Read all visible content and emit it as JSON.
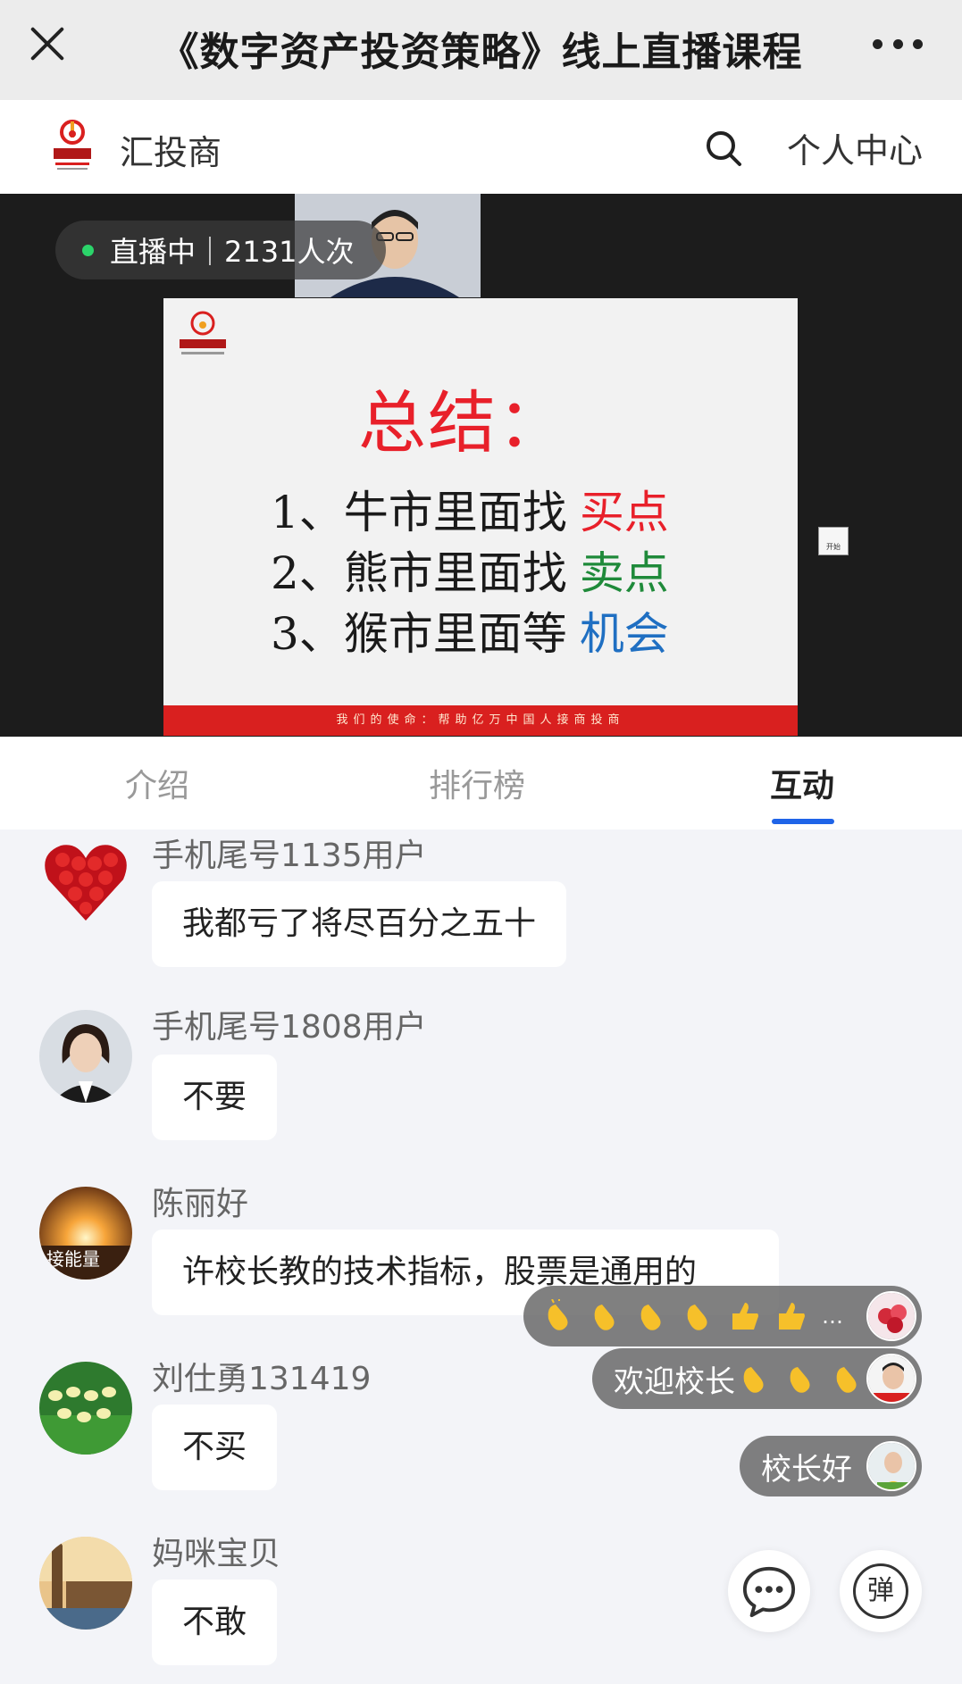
{
  "titlebar": {
    "title": "《数字资产投资策略》线上直播课程"
  },
  "brand": {
    "name": "汇投商",
    "profile_label": "个人中心"
  },
  "video": {
    "live_status": "直播中｜2131人次",
    "side_button_label": "开始",
    "slide": {
      "title": "总结：",
      "lines": [
        {
          "prefix": "1、牛市里面找",
          "highlight": "买点",
          "color": "#e8202a"
        },
        {
          "prefix": "2、熊市里面找",
          "highlight": "卖点",
          "color": "#1f8a3a"
        },
        {
          "prefix": "3、猴市里面等",
          "highlight": "机会",
          "color": "#1f6fc2"
        }
      ],
      "footer": "我们的使命：帮助亿万中国人接商投商"
    }
  },
  "tabs": [
    {
      "label": "介绍",
      "active": false
    },
    {
      "label": "排行榜",
      "active": false
    },
    {
      "label": "互动",
      "active": true
    }
  ],
  "messages": [
    {
      "user": "手机尾号1135用户",
      "text": "我都亏了将尽百分之五十",
      "avatar": "roses-heart"
    },
    {
      "user": "手机尾号1808用户",
      "text": "不要",
      "avatar": "woman-portrait"
    },
    {
      "user": "陈丽好",
      "text": "许校长教的技术指标，股票是通用的",
      "avatar": "sunrise-energy",
      "avatar_caption": "接能量"
    },
    {
      "user": "刘仕勇131419",
      "text": "不买",
      "avatar": "green-lights"
    },
    {
      "user": "妈咪宝贝",
      "text": "不敢",
      "avatar": "london-landmark"
    }
  ],
  "overlay_comments": [
    {
      "text": "",
      "emojis": [
        "clap",
        "clap",
        "clap",
        "clap",
        "thumbs-up",
        "thumbs-up"
      ],
      "ellipsis": "…"
    },
    {
      "text": "欢迎校长",
      "emojis": [
        "clap",
        "clap",
        "clap"
      ]
    },
    {
      "text": "校长好",
      "emojis": []
    }
  ],
  "actions": {
    "danmu_label": "弹"
  },
  "colors": {
    "accent": "#1f64e8",
    "live_dot": "#2bd46a",
    "slide_red": "#e8202a"
  }
}
